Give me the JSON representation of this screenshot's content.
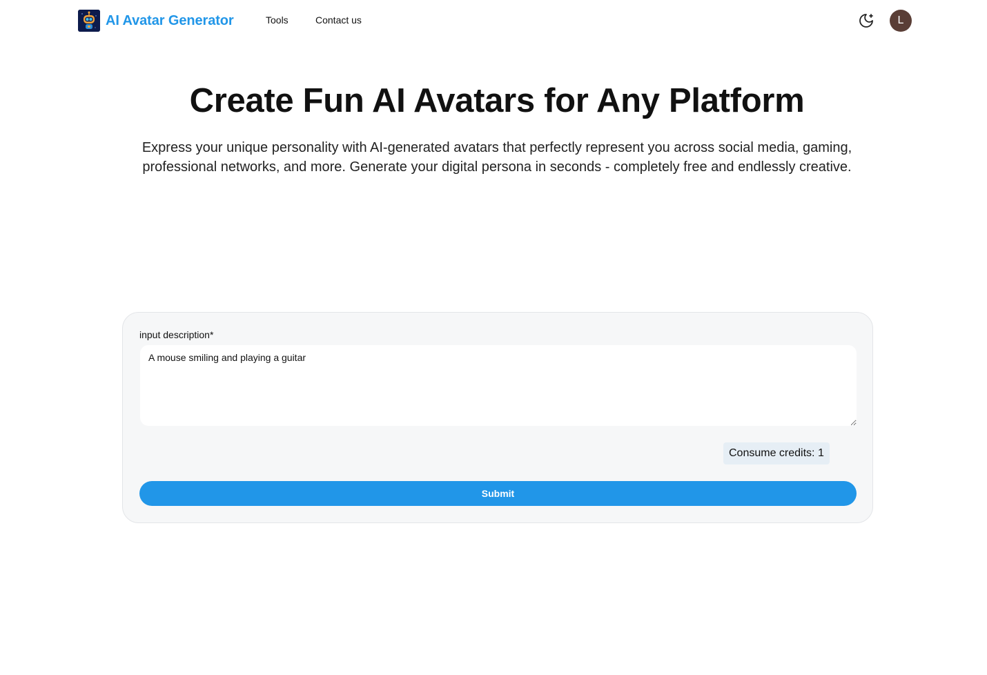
{
  "header": {
    "brand_name": "AI Avatar Generator",
    "logo_icon": "robot-logo-icon",
    "nav": [
      {
        "label": "Tools"
      },
      {
        "label": "Contact us"
      }
    ],
    "theme_toggle_icon": "moon-stars-icon",
    "user_initial": "L"
  },
  "hero": {
    "title": "Create Fun AI Avatars for Any Platform",
    "subtitle": "Express your unique personality with AI-generated avatars that perfectly represent you across social media, gaming, professional networks, and more. Generate your digital persona in seconds - completely free and endlessly creative."
  },
  "form": {
    "label": "input description*",
    "input_value": "A mouse smiling and playing a guitar",
    "credits_text": "Consume credits: 1",
    "submit_label": "Submit"
  },
  "colors": {
    "accent": "#2196e8",
    "avatar_bg": "#5a3e36",
    "card_bg": "#f6f7f8",
    "badge_bg": "#e6eef5"
  }
}
